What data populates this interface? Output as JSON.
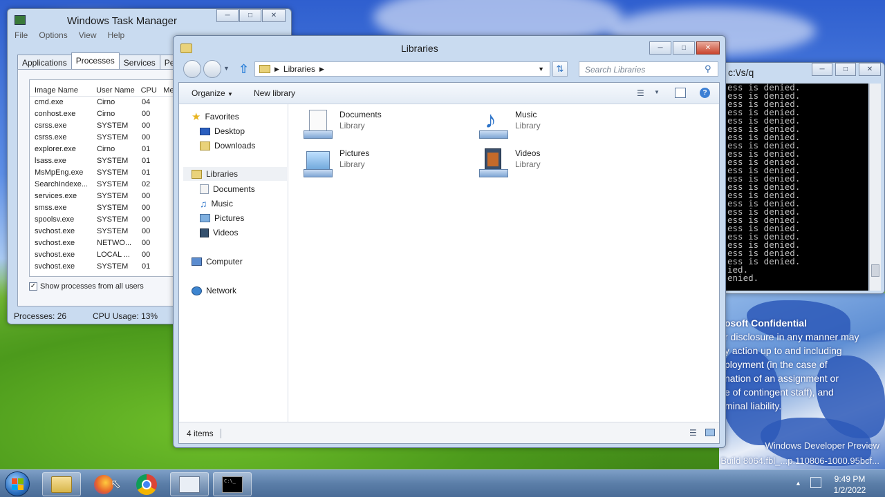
{
  "task_manager": {
    "title": "Windows Task Manager",
    "menu": [
      "File",
      "Options",
      "View",
      "Help"
    ],
    "tabs": [
      "Applications",
      "Processes",
      "Services",
      "Perform"
    ],
    "active_tab": "Processes",
    "columns": [
      "Image Name",
      "User Name",
      "CPU",
      "Me"
    ],
    "processes": [
      {
        "name": "cmd.exe",
        "user": "Cirno",
        "cpu": "04"
      },
      {
        "name": "conhost.exe",
        "user": "Cirno",
        "cpu": "00"
      },
      {
        "name": "csrss.exe",
        "user": "SYSTEM",
        "cpu": "00"
      },
      {
        "name": "csrss.exe",
        "user": "SYSTEM",
        "cpu": "00"
      },
      {
        "name": "explorer.exe",
        "user": "Cirno",
        "cpu": "01"
      },
      {
        "name": "lsass.exe",
        "user": "SYSTEM",
        "cpu": "01"
      },
      {
        "name": "MsMpEng.exe",
        "user": "SYSTEM",
        "cpu": "01"
      },
      {
        "name": "SearchIndexe...",
        "user": "SYSTEM",
        "cpu": "02"
      },
      {
        "name": "services.exe",
        "user": "SYSTEM",
        "cpu": "00"
      },
      {
        "name": "smss.exe",
        "user": "SYSTEM",
        "cpu": "00"
      },
      {
        "name": "spoolsv.exe",
        "user": "SYSTEM",
        "cpu": "00"
      },
      {
        "name": "svchost.exe",
        "user": "SYSTEM",
        "cpu": "00"
      },
      {
        "name": "svchost.exe",
        "user": "NETWO...",
        "cpu": "00"
      },
      {
        "name": "svchost.exe",
        "user": "LOCAL ...",
        "cpu": "00"
      },
      {
        "name": "svchost.exe",
        "user": "SYSTEM",
        "cpu": "01"
      }
    ],
    "show_all_label": "Show processes from all users",
    "show_all_checked": true,
    "status_processes": "Processes: 26",
    "status_cpu": "CPU Usage: 13%"
  },
  "cmd": {
    "title": "c:\\/s/q",
    "lines": [
      "ess is denied.",
      "ess is denied.",
      "ess is denied.",
      "ess is denied.",
      "ess is denied.",
      "ess is denied.",
      "ess is denied.",
      "ess is denied.",
      "ess is denied.",
      "ess is denied.",
      "ess is denied.",
      "ess is denied.",
      "ess is denied.",
      "ess is denied.",
      "ess is denied.",
      "ess is denied.",
      "ess is denied.",
      "ess is denied.",
      "ess is denied.",
      "ess is denied.",
      "ess is denied.",
      "ess is denied.",
      "ied.",
      "enied."
    ]
  },
  "explorer": {
    "title": "Libraries",
    "breadcrumb": "Libraries",
    "search_placeholder": "Search Libraries",
    "toolbar": {
      "organize": "Organize",
      "new_library": "New library"
    },
    "nav": {
      "favorites": "Favorites",
      "favorites_items": [
        "Desktop",
        "Downloads"
      ],
      "libraries": "Libraries",
      "libraries_items": [
        "Documents",
        "Music",
        "Pictures",
        "Videos"
      ],
      "computer": "Computer",
      "network": "Network"
    },
    "libraries": [
      {
        "name": "Documents",
        "type": "Library",
        "icon": "documents-library-icon"
      },
      {
        "name": "Music",
        "type": "Library",
        "icon": "music-library-icon"
      },
      {
        "name": "Pictures",
        "type": "Library",
        "icon": "pictures-library-icon"
      },
      {
        "name": "Videos",
        "type": "Library",
        "icon": "videos-library-icon"
      }
    ],
    "status": "4 items"
  },
  "desktop": {
    "confidential_title": "osoft Confidential",
    "confidential_lines": [
      "r disclosure in any manner may",
      "y action up to and including",
      "ployment (in the case of",
      "nation of an assignment or",
      "e of contingent staff), and",
      "minal liability."
    ],
    "watermark_line1": "Windows Developer Preview",
    "watermark_line2": "Build 8064.fbl_...p.110806-1000.95bcf..."
  },
  "taskbar": {
    "apps": [
      "start-orb",
      "explorer",
      "firefox",
      "chrome",
      "task-manager",
      "cmd"
    ],
    "time": "9:49 PM",
    "date": "1/2/2022"
  }
}
